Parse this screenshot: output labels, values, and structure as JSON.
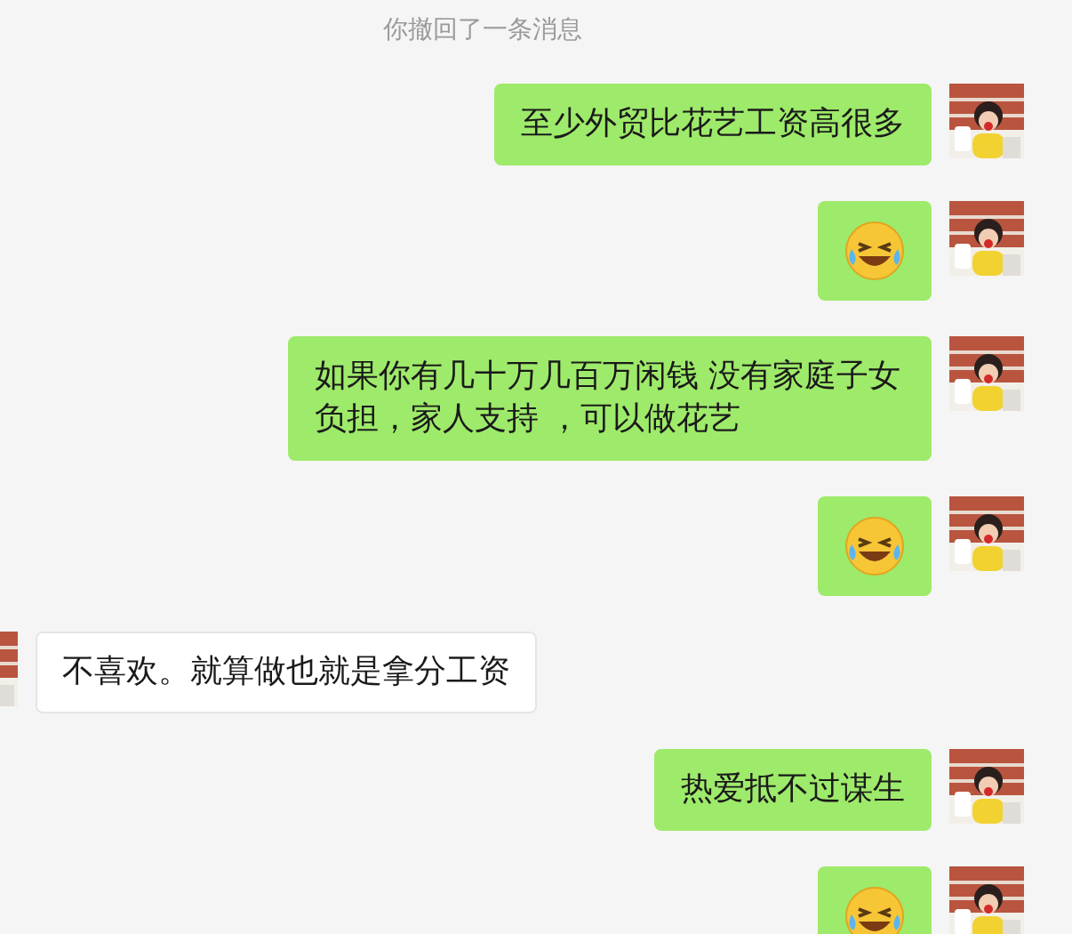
{
  "system_notice": "你撤回了一条消息",
  "messages": [
    {
      "kind": "text",
      "outgoing": true,
      "text": "至少外贸比花艺工资高很多"
    },
    {
      "kind": "emoji",
      "outgoing": true
    },
    {
      "kind": "text",
      "outgoing": true,
      "text": "如果你有几十万几百万闲钱 没有家庭子女负担，家人支持 ，可以做花艺"
    },
    {
      "kind": "emoji",
      "outgoing": true
    },
    {
      "kind": "text",
      "outgoing": false,
      "text": "不喜欢。就算做也就是拿分工资"
    },
    {
      "kind": "text",
      "outgoing": true,
      "text": "热爱抵不过谋生"
    },
    {
      "kind": "emoji",
      "outgoing": true
    }
  ]
}
